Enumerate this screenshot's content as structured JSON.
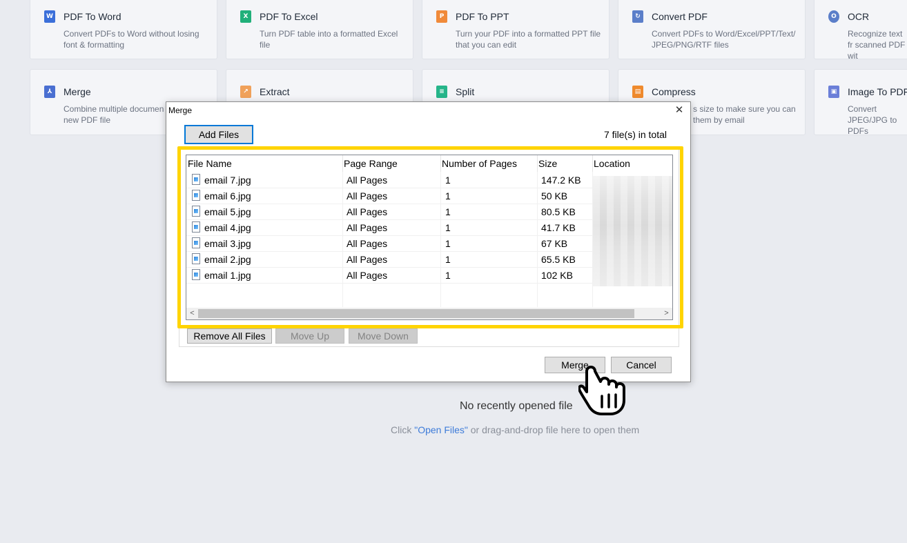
{
  "tools": [
    {
      "title": "PDF To Word",
      "desc": "Convert PDFs to Word without losing font & formatting",
      "icon": "word-icon",
      "color": "#3b6fd9",
      "glyph": "W"
    },
    {
      "title": "PDF To Excel",
      "desc": "Turn PDF table into a formatted Excel file",
      "icon": "excel-icon",
      "color": "#21b07a",
      "glyph": "X"
    },
    {
      "title": "PDF To PPT",
      "desc": "Turn your PDF into a formatted PPT file that you can edit",
      "icon": "ppt-icon",
      "color": "#f08a3a",
      "glyph": "P"
    },
    {
      "title": "Convert PDF",
      "desc": "Convert PDFs to Word/Excel/PPT/Text/ JPEG/PNG/RTF files",
      "icon": "convert-icon",
      "color": "#5b7ec9",
      "glyph": "↻"
    },
    {
      "title": "OCR",
      "desc": "Recognize text fr scanned PDF wit",
      "icon": "ocr-icon",
      "color": "#5b7ec9",
      "glyph": "O"
    },
    {
      "title": "Merge",
      "desc": "Combine multiple documen new PDF file",
      "icon": "merge-icon",
      "color": "#4a6fd1",
      "glyph": "⅄"
    },
    {
      "title": "Extract",
      "desc": "",
      "icon": "extract-icon",
      "color": "#f0a15a",
      "glyph": "↗"
    },
    {
      "title": "Split",
      "desc": "",
      "icon": "split-icon",
      "color": "#26b58a",
      "glyph": "≡"
    },
    {
      "title": "Compress",
      "desc": "s size to make sure you can them by email",
      "icon": "compress-icon",
      "color": "#ef8a2d",
      "glyph": "▤"
    },
    {
      "title": "Image To PDF",
      "desc": "Convert JPEG/JPG to PDFs",
      "icon": "image-to-pdf-icon",
      "color": "#6b7fd8",
      "glyph": "▣"
    }
  ],
  "empty": {
    "title": "No recently opened file",
    "hint_prefix": "Click ",
    "hint_link": "\"Open Files\"",
    "hint_suffix": " or drag-and-drop file here to open them"
  },
  "dialog": {
    "title": "Merge",
    "close": "✕",
    "add_files": "Add Files",
    "total": "7 file(s) in total",
    "columns": [
      "File Name",
      "Page Range",
      "Number of Pages",
      "Size",
      "Location"
    ],
    "rows": [
      {
        "name": "email 7.jpg",
        "range": "All Pages",
        "pages": "1",
        "size": "147.2 KB"
      },
      {
        "name": "email 6.jpg",
        "range": "All Pages",
        "pages": "1",
        "size": "50 KB"
      },
      {
        "name": "email 5.jpg",
        "range": "All Pages",
        "pages": "1",
        "size": "80.5 KB"
      },
      {
        "name": "email 4.jpg",
        "range": "All Pages",
        "pages": "1",
        "size": "41.7 KB"
      },
      {
        "name": "email 3.jpg",
        "range": "All Pages",
        "pages": "1",
        "size": "67 KB"
      },
      {
        "name": "email 2.jpg",
        "range": "All Pages",
        "pages": "1",
        "size": "65.5 KB"
      },
      {
        "name": "email 1.jpg",
        "range": "All Pages",
        "pages": "1",
        "size": "102 KB"
      }
    ],
    "remove_all": "Remove All Files",
    "move_up": "Move Up",
    "move_down": "Move Down",
    "merge": "Merge",
    "cancel": "Cancel",
    "scroll_left": "<",
    "scroll_right": ">"
  },
  "colors": {
    "highlight": "#ffd400",
    "link": "#3d7bd9",
    "primary_border": "#0078d7"
  }
}
